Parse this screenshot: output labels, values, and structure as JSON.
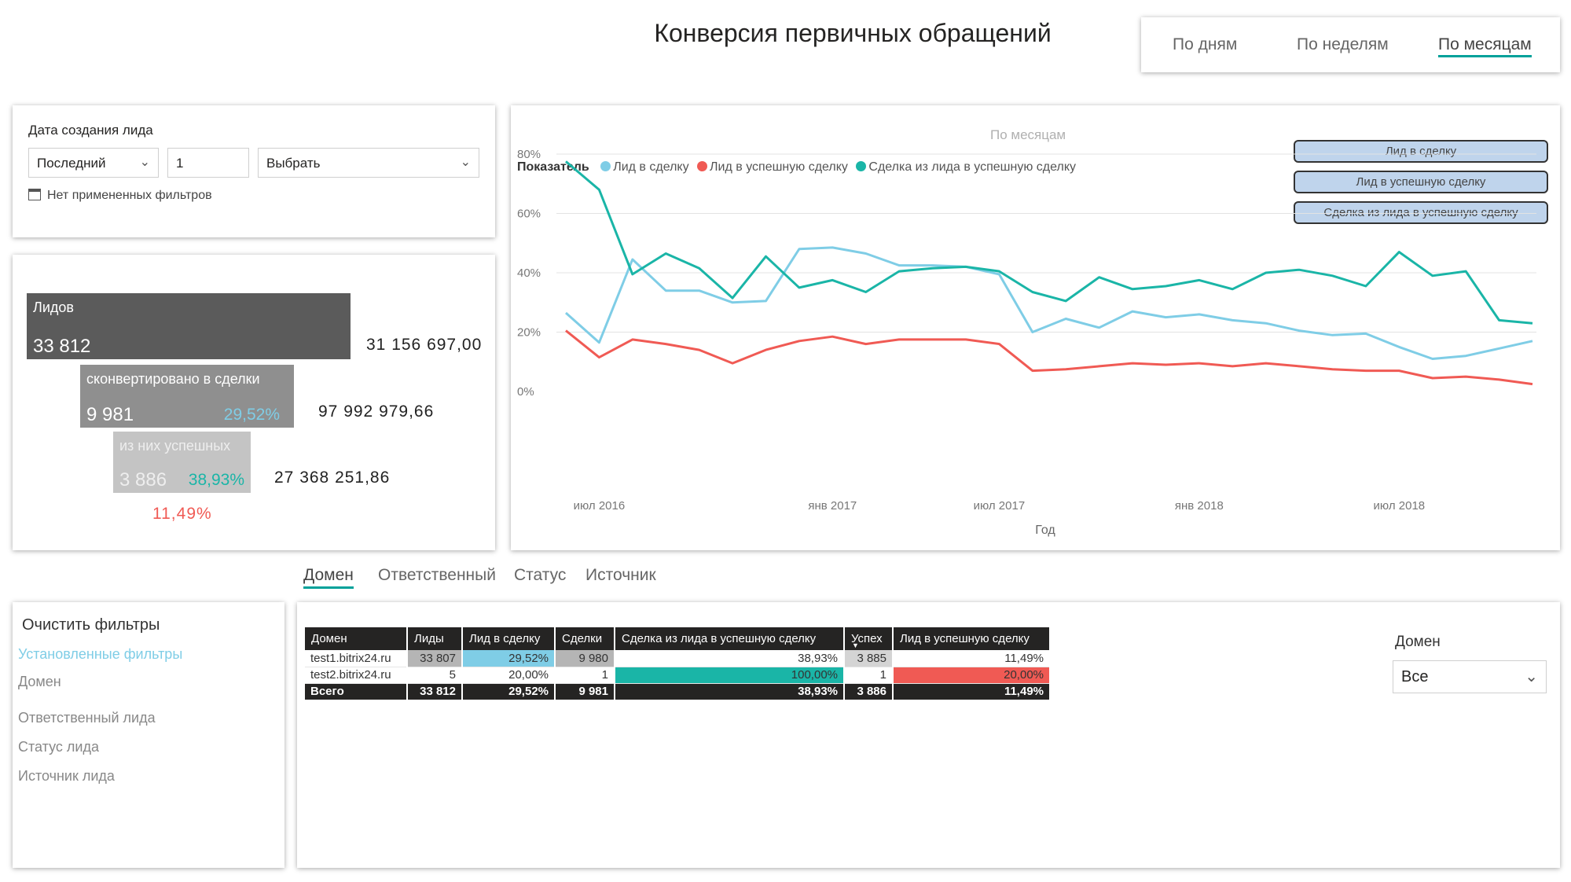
{
  "title": "Конверсия первичных обращений",
  "period_tabs": [
    {
      "label": "По дням"
    },
    {
      "label": "По неделям"
    },
    {
      "label": "По месяцам",
      "active": true
    }
  ],
  "filter": {
    "title": "Дата создания лида",
    "relative": "Последний",
    "count": "1",
    "unit": "Выбрать",
    "status": "Нет примененных фильтров"
  },
  "funnel": [
    {
      "label": "Лидов",
      "value": "33 812",
      "pct": "",
      "amount": "31 156 697,00"
    },
    {
      "label": "сконвертировано в сделки",
      "value": "9 981",
      "pct": "29,52%",
      "amount": "97 992 979,66"
    },
    {
      "label": "из них успешных",
      "value": "3 886",
      "pct": "38,93%",
      "amount": "27 368 251,86"
    }
  ],
  "funnel_overall": "11,49%",
  "chart": {
    "subtitle": "По месяцам",
    "legend_title": "Показатель",
    "buttons": [
      "Лид в сделку",
      "Лид в успешную сделку",
      "Сделка из лида в успешную сделку"
    ]
  },
  "chart_data": {
    "type": "line",
    "title": "По месяцам",
    "xlabel": "Год",
    "ylabel": "",
    "ylim": [
      0,
      80
    ],
    "yticks": [
      "0%",
      "20%",
      "40%",
      "60%",
      "80%"
    ],
    "x": [
      "2016-05",
      "2016-06",
      "2016-07",
      "2016-08",
      "2016-09",
      "2016-10",
      "2016-11",
      "2016-12",
      "2017-01",
      "2017-02",
      "2017-03",
      "2017-04",
      "2017-05",
      "2017-06",
      "2017-07",
      "2017-08",
      "2017-09",
      "2017-10",
      "2017-11",
      "2017-12",
      "2018-01",
      "2018-02",
      "2018-03",
      "2018-04",
      "2018-05",
      "2018-06",
      "2018-07",
      "2018-08",
      "2018-09",
      "2018-10"
    ],
    "xticks": [
      {
        "pos": 1,
        "label": "июл 2016"
      },
      {
        "pos": 8,
        "label": "янв 2017"
      },
      {
        "pos": 13,
        "label": "июл 2017"
      },
      {
        "pos": 19,
        "label": "янв 2018"
      },
      {
        "pos": 25,
        "label": "июл 2018"
      }
    ],
    "grid": true,
    "legend": "top-left",
    "series": [
      {
        "name": "Лид в сделку",
        "color": "#7fcde6",
        "values": [
          26.5,
          16.5,
          44.5,
          34,
          34,
          30,
          30.5,
          48,
          48.5,
          46.5,
          42.5,
          42.5,
          42,
          39.5,
          20,
          24.5,
          21.5,
          27,
          25,
          26,
          24,
          23,
          20.5,
          19,
          19.5,
          15,
          11,
          12,
          14.5,
          17
        ]
      },
      {
        "name": "Лид в успешную сделку",
        "color": "#f05a54",
        "values": [
          20.5,
          11.5,
          17.5,
          16,
          14,
          9.5,
          14,
          17,
          18.5,
          16,
          17.5,
          17.5,
          17.5,
          16,
          7,
          7.5,
          8.5,
          9.5,
          9,
          9.5,
          8.5,
          9.5,
          8.5,
          7.5,
          7,
          7,
          4.5,
          5,
          4,
          2.5
        ]
      },
      {
        "name": "Сделка из лида в успешную сделку",
        "color": "#1ab5a7",
        "values": [
          77.5,
          68,
          39.5,
          46.5,
          41.5,
          31.5,
          45.5,
          35,
          37.5,
          33.5,
          40.5,
          41.5,
          42,
          40.5,
          33.5,
          30.5,
          38.5,
          34.5,
          35.5,
          37.5,
          34.5,
          40,
          41,
          39,
          35.5,
          47,
          39,
          40.5,
          24,
          23
        ]
      }
    ]
  },
  "dimension_tabs": [
    {
      "label": "Домен",
      "active": true
    },
    {
      "label": "Ответственный"
    },
    {
      "label": "Статус"
    },
    {
      "label": "Источник"
    }
  ],
  "side_panel": {
    "clear": "Очистить фильтры",
    "applied": "Установленные фильтры",
    "items": [
      "Домен",
      "Ответственный лида",
      "Статус лида",
      "Источник лида"
    ]
  },
  "table": {
    "headers": [
      "Домен",
      "Лиды",
      "Лид в сделку",
      "Сделки",
      "Сделка из лида в успешную сделку",
      "Успех",
      "Лид в успешную сделку"
    ],
    "rows": [
      [
        "test1.bitrix24.ru",
        "33 807",
        "29,52%",
        "9 980",
        "38,93%",
        "3 885",
        "11,49%"
      ],
      [
        "test2.bitrix24.ru",
        "5",
        "20,00%",
        "1",
        "100,00%",
        "1",
        "20,00%"
      ]
    ],
    "total": [
      "Всего",
      "33 812",
      "29,52%",
      "9 981",
      "38,93%",
      "3 886",
      "11,49%"
    ]
  },
  "domain_slicer": {
    "label": "Домен",
    "value": "Все"
  },
  "colors": {
    "accent": "#00a19a",
    "teal": "#1ab5a7",
    "red": "#f05a54",
    "light_blue": "#7fcde6",
    "dark": "#252423"
  }
}
